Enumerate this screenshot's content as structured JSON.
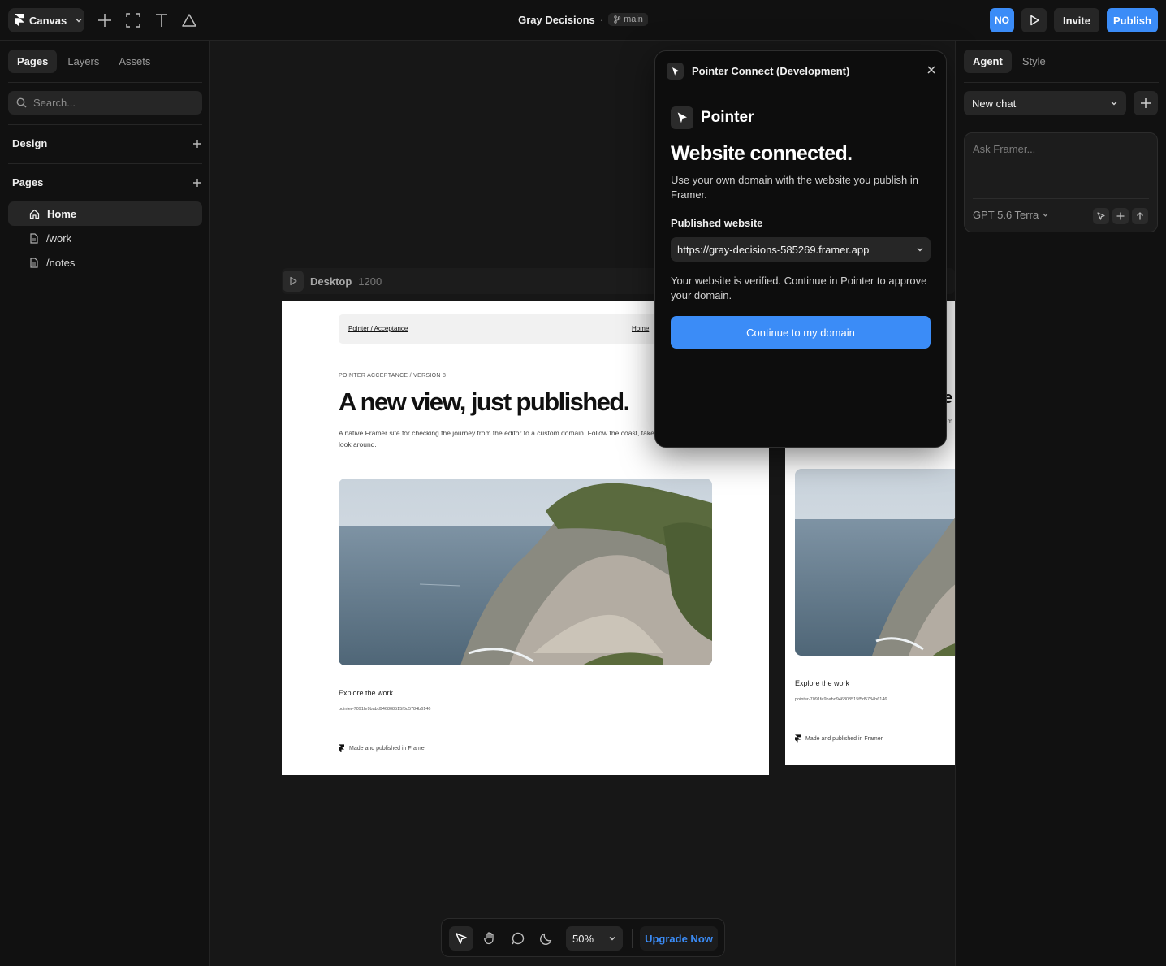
{
  "topbar": {
    "workspace_label": "Canvas",
    "project_title": "Gray Decisions",
    "separator": "·",
    "branch": "main",
    "avatar_initials": "NO",
    "invite_label": "Invite",
    "publish_label": "Publish"
  },
  "left_panel": {
    "tabs": [
      {
        "label": "Pages",
        "active": true
      },
      {
        "label": "Layers",
        "active": false
      },
      {
        "label": "Assets",
        "active": false
      }
    ],
    "search_placeholder": "Search...",
    "sections": [
      {
        "label": "Design"
      },
      {
        "label": "Pages"
      }
    ],
    "pages": [
      {
        "label": "Home",
        "icon": "home-icon",
        "active": true
      },
      {
        "label": "/work",
        "icon": "file-icon",
        "active": false
      },
      {
        "label": "/notes",
        "icon": "file-icon",
        "active": false
      }
    ]
  },
  "canvas": {
    "frame_name": "Desktop",
    "frame_width": "1200",
    "site": {
      "brand": "Pointer / Acceptance",
      "nav_home": "Home",
      "kicker": "POINTER ACCEPTANCE / VERSION 8",
      "headline": "A new view, just published.",
      "paragraph": "A native Framer site for checking the journey from the editor to a custom domain. Follow the coast, take a look around.",
      "explore": "Explore the work",
      "hash": "pointer-7091fe9babd946808515f5d5784b6146",
      "footer": "Made and published in Framer"
    },
    "tablet": {
      "headline_fragment": "e",
      "paragraph_fragment": "om",
      "explore": "Explore the work",
      "hash": "pointer-7091fe9babd946808515f5d5784b6146",
      "footer": "Made and published in Framer"
    }
  },
  "modal": {
    "header_title": "Pointer Connect (Development)",
    "brand_name": "Pointer",
    "title": "Website connected.",
    "subtitle": "Use your own domain with the website you publish in Framer.",
    "published_label": "Published website",
    "published_url": "https://gray-decisions-585269.framer.app",
    "verify_text": "Your website is verified. Continue in Pointer to approve your domain.",
    "cta_label": "Continue to my domain"
  },
  "right_panel": {
    "tabs": [
      {
        "label": "Agent",
        "active": true
      },
      {
        "label": "Style",
        "active": false
      }
    ],
    "chat_select": "New chat",
    "ask_placeholder": "Ask Framer...",
    "model": "GPT 5.6 Terra"
  },
  "bottom_toolbar": {
    "zoom": "50%",
    "upgrade_label": "Upgrade Now"
  },
  "colors": {
    "accent": "#3b8cf7",
    "panel_bg": "#111111",
    "canvas_bg": "#171717",
    "control_bg": "#262626"
  }
}
